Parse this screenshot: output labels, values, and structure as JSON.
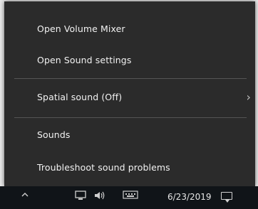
{
  "menu": {
    "items": [
      {
        "label": "Open Volume Mixer"
      },
      {
        "label": "Open Sound settings"
      },
      {
        "label": "Spatial sound (Off)",
        "chevron": "›"
      },
      {
        "label": "Sounds"
      },
      {
        "label": "Troubleshoot sound problems"
      }
    ]
  },
  "taskbar": {
    "date": "6/23/2019",
    "tray_icons": [
      "chevron-up-icon",
      "network-icon",
      "volume-icon",
      "keyboard-icon",
      "notification-icon"
    ]
  },
  "colors": {
    "menu_bg": "#2b2b2b",
    "menu_text": "#f2f2f2",
    "separator": "#555555",
    "taskbar_bg": "#101418"
  }
}
